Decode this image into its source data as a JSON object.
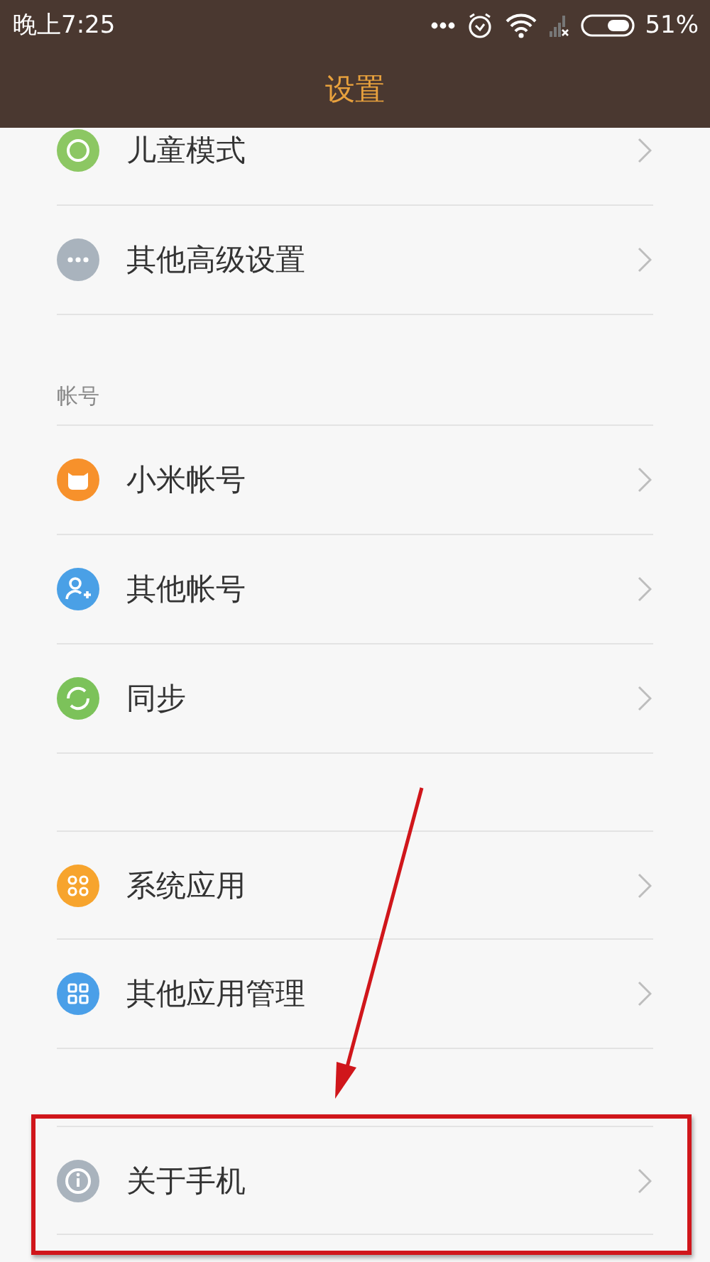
{
  "status_bar": {
    "time": "晚上7:25",
    "battery": "51%"
  },
  "title": "设置",
  "sections": [
    {
      "items": [
        {
          "label": "儿童模式",
          "kind": "child",
          "color": "#8cc763"
        },
        {
          "label": "其他高级设置",
          "kind": "more",
          "color": "#a9b3bd"
        }
      ]
    },
    {
      "header": "帐号",
      "items": [
        {
          "label": "小米帐号",
          "kind": "mi",
          "color": "#f7912b"
        },
        {
          "label": "其他帐号",
          "kind": "account",
          "color": "#4aa0e6"
        },
        {
          "label": "同步",
          "kind": "sync",
          "color": "#7cc25a"
        }
      ]
    },
    {
      "items": [
        {
          "label": "系统应用",
          "kind": "apps",
          "color": "#f7a42d"
        },
        {
          "label": "其他应用管理",
          "kind": "manage",
          "color": "#4a9fe8"
        }
      ]
    },
    {
      "items": [
        {
          "label": "关于手机",
          "kind": "info",
          "color": "#a9b3bd"
        }
      ]
    }
  ]
}
